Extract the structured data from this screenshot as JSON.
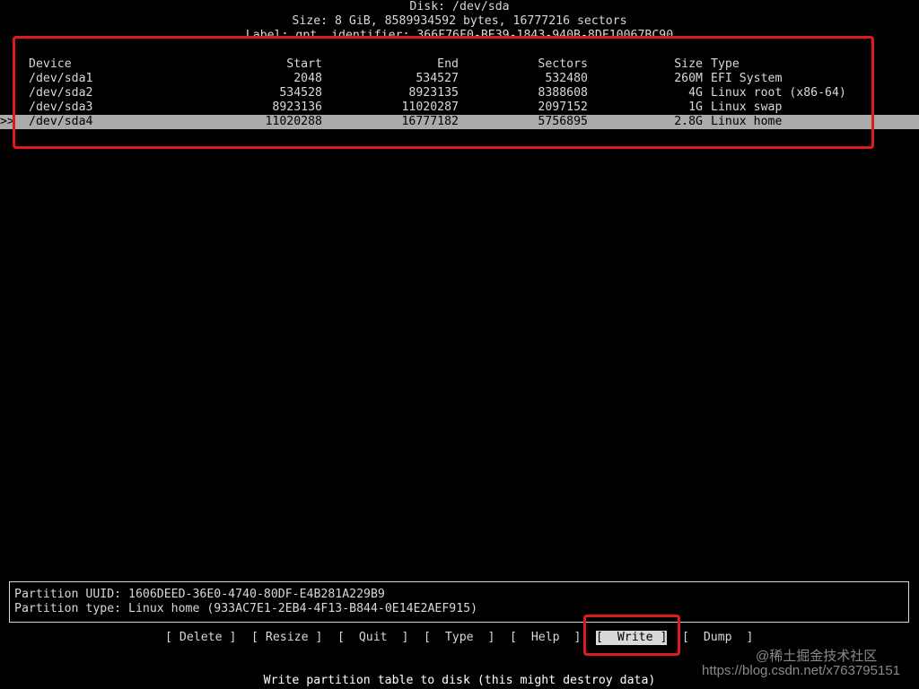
{
  "header": {
    "disk": "Disk: /dev/sda",
    "size": "Size: 8 GiB, 8589934592 bytes, 16777216 sectors",
    "label": "Label: gpt, identifier: 366F76F0-BE39-1843-940B-8DF10067BC90"
  },
  "table": {
    "columns": {
      "device": "Device",
      "start": "Start",
      "end": "End",
      "sectors": "Sectors",
      "size": "Size",
      "type": "Type"
    },
    "selected_marker": ">>",
    "rows": [
      {
        "device": "/dev/sda1",
        "start": "2048",
        "end": "534527",
        "sectors": "532480",
        "size": "260M",
        "type": "EFI System"
      },
      {
        "device": "/dev/sda2",
        "start": "534528",
        "end": "8923135",
        "sectors": "8388608",
        "size": "4G",
        "type": "Linux root (x86-64)"
      },
      {
        "device": "/dev/sda3",
        "start": "8923136",
        "end": "11020287",
        "sectors": "2097152",
        "size": "1G",
        "type": "Linux swap"
      },
      {
        "device": "/dev/sda4",
        "start": "11020288",
        "end": "16777182",
        "sectors": "5756895",
        "size": "2.8G",
        "type": "Linux home"
      }
    ],
    "selected_index": 3
  },
  "info": {
    "uuid": "Partition UUID: 1606DEED-36E0-4740-80DF-E4B281A229B9",
    "type": "Partition type: Linux home (933AC7E1-2EB4-4F13-B844-0E14E2AEF915)"
  },
  "menu": {
    "delete": "[ Delete ]",
    "resize": "[ Resize ]",
    "quit": "[  Quit  ]",
    "type": "[  Type  ]",
    "help": "[  Help  ]",
    "write": "[  Write ]",
    "dump": "[  Dump  ]",
    "selected": "write"
  },
  "status": "Write partition table to disk (this might destroy data)",
  "watermark": {
    "line1": "@稀土掘金技术社区",
    "line2": "https://blog.csdn.net/x763795151"
  },
  "colors": {
    "annotation": "#e01a1a",
    "highlight": "#aaaaaa"
  }
}
